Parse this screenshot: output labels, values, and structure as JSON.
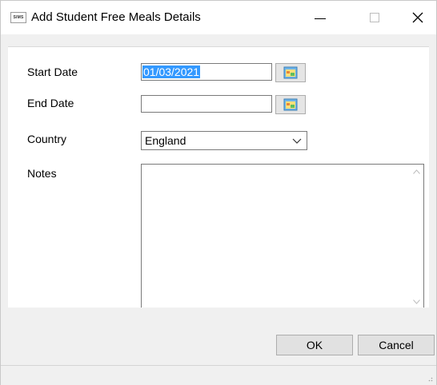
{
  "window": {
    "title": "Add Student Free Meals Details",
    "app_icon_text": "SIMS",
    "controls": {
      "minimize": "—",
      "close": "✕"
    }
  },
  "form": {
    "start_date": {
      "label": "Start Date",
      "value": "01/03/2021"
    },
    "end_date": {
      "label": "End Date",
      "value": ""
    },
    "country": {
      "label": "Country",
      "value": "England"
    },
    "notes": {
      "label": "Notes",
      "value": ""
    }
  },
  "buttons": {
    "ok": "OK",
    "cancel": "Cancel"
  },
  "icons": {
    "calendar": "calendar-icon",
    "dropdown": "chevron-down-icon"
  },
  "colors": {
    "selection": "#3399ff",
    "window_bg": "#f0f0f0"
  }
}
